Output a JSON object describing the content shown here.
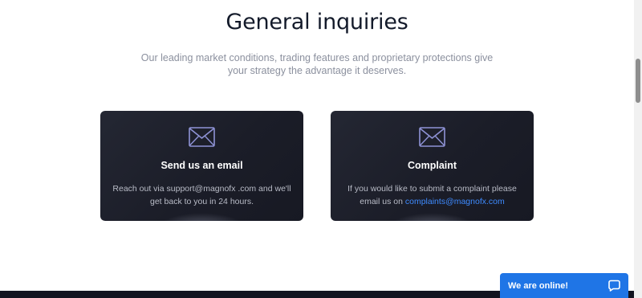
{
  "page": {
    "title": "General inquiries",
    "subtitle": "Our leading market conditions, trading features and proprietary protections give your strategy the advantage it deserves."
  },
  "cards": [
    {
      "icon": "envelope-icon",
      "title": "Send us an email",
      "text": "Reach out via support@magnofx .com and we'll get back to you in 24 hours."
    },
    {
      "icon": "envelope-icon",
      "title": "Complaint",
      "text_prefix": "If you would like to submit a complaint please email us on",
      "link_text": "complaints@magnofx.com"
    }
  ],
  "chat_widget": {
    "label": "We are online!",
    "icon": "chat-bubble-icon"
  },
  "colors": {
    "title": "#131a2a",
    "card_bg": "#1b1d28",
    "link": "#3e8bff",
    "chat_bg": "#1f75e6",
    "envelope": "#8f93d6"
  }
}
